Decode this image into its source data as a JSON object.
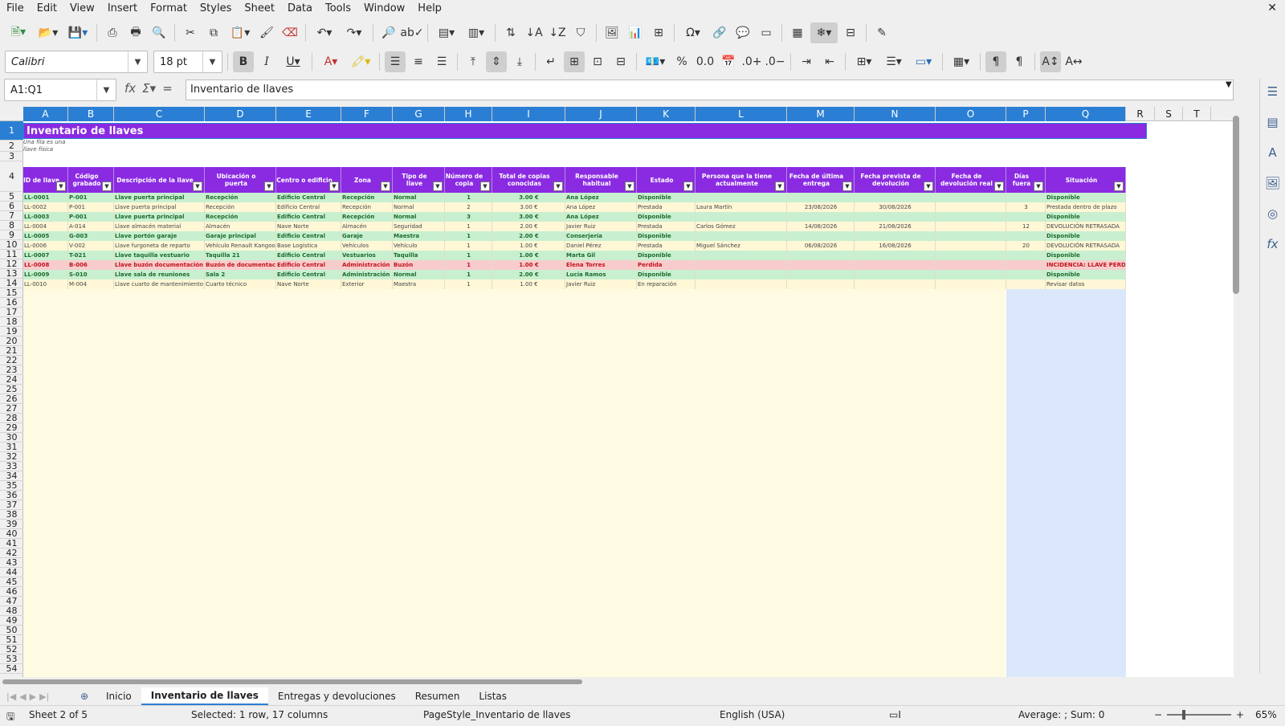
{
  "menu": [
    "File",
    "Edit",
    "View",
    "Insert",
    "Format",
    "Styles",
    "Sheet",
    "Data",
    "Tools",
    "Window",
    "Help"
  ],
  "font": {
    "name": "Calibri",
    "size": "18 pt"
  },
  "namebox": "A1:Q1",
  "formula": "Inventario de llaves",
  "columns": [
    "A",
    "B",
    "C",
    "D",
    "E",
    "F",
    "G",
    "H",
    "I",
    "J",
    "K",
    "L",
    "M",
    "N",
    "O",
    "P",
    "Q",
    "R",
    "S",
    "T"
  ],
  "rows": [
    "1",
    "2",
    "3",
    "4",
    "5",
    "6",
    "7",
    "8",
    "9",
    "10",
    "11",
    "12",
    "13",
    "14",
    "15",
    "16",
    "17",
    "18",
    "19",
    "20",
    "21",
    "22",
    "23",
    "24",
    "25",
    "26",
    "27",
    "28",
    "29",
    "30",
    "31",
    "32",
    "33",
    "34",
    "35",
    "36",
    "37",
    "38",
    "39",
    "40",
    "41",
    "42",
    "43",
    "44",
    "45",
    "46",
    "47",
    "48",
    "49",
    "50",
    "51",
    "52",
    "53",
    "54"
  ],
  "sheet": {
    "title": "Inventario de llaves",
    "note": "Una fila es una llave física",
    "headers": [
      "ID de llave",
      "Código grabado",
      "Descripción de la llave",
      "Ubicación o puerta",
      "Centro o edificio",
      "Zona",
      "Tipo de llave",
      "Número de copia",
      "Total de copias conocidas",
      "Responsable habitual",
      "Estado",
      "Persona que la tiene actualmente",
      "Fecha de última entrega",
      "Fecha prevista de devolución",
      "Fecha de devolución real",
      "Días fuera",
      "Situación"
    ],
    "data": [
      {
        "style": "green",
        "cells": [
          "LL-0001",
          "P-001",
          "Llave puerta principal",
          "Recepción",
          "Edificio Central",
          "Recepción",
          "Normal",
          "1",
          "3.00 €",
          "Ana López",
          "Disponible",
          "",
          "",
          "",
          "",
          "",
          "Disponible"
        ]
      },
      {
        "style": "yellow",
        "cells": [
          "LL-0002",
          "P-001",
          "Llave puerta principal",
          "Recepción",
          "Edificio Central",
          "Recepción",
          "Normal",
          "2",
          "3.00 €",
          "Ana López",
          "Prestada",
          "Laura Martín",
          "23/08/2026",
          "30/08/2026",
          "",
          "3",
          "Prestada dentro de plazo"
        ]
      },
      {
        "style": "green",
        "cells": [
          "LL-0003",
          "P-001",
          "Llave puerta principal",
          "Recepción",
          "Edificio Central",
          "Recepción",
          "Normal",
          "3",
          "3.00 €",
          "Ana López",
          "Disponible",
          "",
          "",
          "",
          "",
          "",
          "Disponible"
        ]
      },
      {
        "style": "yellow",
        "cells": [
          "LL-0004",
          "A-014",
          "Llave almacén material",
          "Almacén",
          "Nave Norte",
          "Almacén",
          "Seguridad",
          "1",
          "2.00 €",
          "Javier Ruiz",
          "Prestada",
          "Carlos Gómez",
          "14/08/2026",
          "21/08/2026",
          "",
          "12",
          "DEVOLUCIÓN RETRASADA"
        ]
      },
      {
        "style": "green",
        "cells": [
          "LL-0005",
          "G-003",
          "Llave portón garaje",
          "Garaje principal",
          "Edificio Central",
          "Garaje",
          "Maestra",
          "1",
          "2.00 €",
          "Conserjería",
          "Disponible",
          "",
          "",
          "",
          "",
          "",
          "Disponible"
        ]
      },
      {
        "style": "yellow",
        "cells": [
          "LL-0006",
          "V-002",
          "Llave furgoneta de reparto",
          "Vehículo Renault Kangoo",
          "Base Logística",
          "Vehículos",
          "Vehículo",
          "1",
          "1.00 €",
          "Daniel Pérez",
          "Prestada",
          "Miguel Sánchez",
          "06/08/2026",
          "16/08/2026",
          "",
          "20",
          "DEVOLUCIÓN RETRASADA"
        ]
      },
      {
        "style": "green",
        "cells": [
          "LL-0007",
          "T-021",
          "Llave taquilla vestuario",
          "Taquilla 21",
          "Edificio Central",
          "Vestuarios",
          "Taquilla",
          "1",
          "1.00 €",
          "Marta Gil",
          "Disponible",
          "",
          "",
          "",
          "",
          "",
          "Disponible"
        ]
      },
      {
        "style": "red",
        "cells": [
          "LL-0008",
          "B-006",
          "Llave buzón documentación",
          "Buzón de documentación",
          "Edificio Central",
          "Administración",
          "Buzón",
          "1",
          "1.00 €",
          "Elena Torres",
          "Perdida",
          "",
          "",
          "",
          "",
          "",
          "INCIDENCIA: LLAVE PERDIDA"
        ]
      },
      {
        "style": "green",
        "cells": [
          "LL-0009",
          "S-010",
          "Llave sala de reuniones",
          "Sala 2",
          "Edificio Central",
          "Administración",
          "Normal",
          "1",
          "2.00 €",
          "Lucía Ramos",
          "Disponible",
          "",
          "",
          "",
          "",
          "",
          "Disponible"
        ]
      },
      {
        "style": "yellow",
        "cells": [
          "LL-0010",
          "M-004",
          "Llave cuarto de mantenimiento",
          "Cuarto técnico",
          "Nave Norte",
          "Exterior",
          "Maestra",
          "1",
          "1.00 €",
          "Javier Ruiz",
          "En reparación",
          "",
          "",
          "",
          "",
          "",
          "Revisar datos"
        ]
      }
    ]
  },
  "tabs": [
    "Inicio",
    "Inventario de llaves",
    "Entregas y devoluciones",
    "Resumen",
    "Listas"
  ],
  "status": {
    "sheet": "Sheet 2 of 5",
    "selection": "Selected: 1 row, 17 columns",
    "pagestyle": "PageStyle_Inventario de llaves",
    "language": "English (USA)",
    "summary": "Average: ; Sum: 0",
    "zoom": "65%"
  }
}
